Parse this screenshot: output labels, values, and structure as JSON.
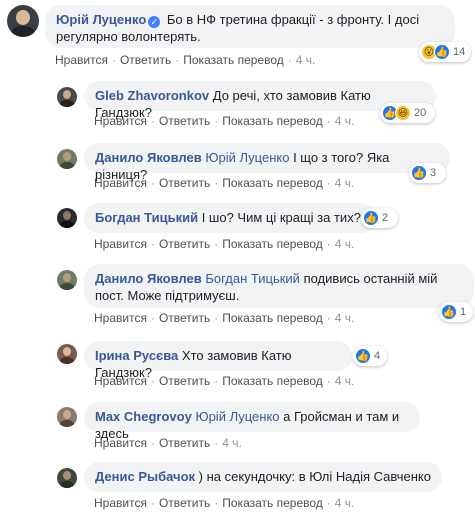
{
  "comments": [
    {
      "author": "Юрій Луценко",
      "verified": true,
      "text": "Бо в НФ третина фракції - з фронту. І досі регулярно волонтерять.",
      "actions": {
        "like": "Нравится",
        "reply": "Ответить",
        "translate": "Показать перевод",
        "time": "4 ч."
      },
      "reactions": {
        "icons": [
          "wow-icon",
          "like-icon"
        ],
        "count": "14"
      },
      "colors": {
        "avatar": "#3a3f45",
        "face": "#d9b89a"
      }
    },
    {
      "author": "Gleb Zhavoronkov",
      "mention": "",
      "text": "До речі, хто замовив Катю Гандзюк?",
      "actions": {
        "like": "Нравится",
        "reply": "Ответить",
        "translate": "Показать перевод",
        "time": "4 ч."
      },
      "reactions": {
        "icons": [
          "like-icon",
          "haha-icon"
        ],
        "count": "20"
      },
      "colors": {
        "avatar": "#4a4a4a",
        "face": "#c9a98a"
      }
    },
    {
      "author": "Данило Яковлев",
      "mention": "Юрій Луценко",
      "text": "І що з того? Яка різниця?",
      "actions": {
        "like": "Нравится",
        "reply": "Ответить",
        "translate": "Показать перевод",
        "time": "4 ч."
      },
      "reactions": {
        "icons": [
          "like-icon"
        ],
        "count": "3"
      },
      "colors": {
        "avatar": "#6e7d66",
        "face": "#b59a80"
      }
    },
    {
      "author": "Богдан Тицький",
      "mention": "",
      "text": "І шо? Чим ці кращі за тих?",
      "actions": {
        "like": "Нравится",
        "reply": "Ответить",
        "translate": "Показать перевод",
        "time": "4 ч."
      },
      "reactions": {
        "icons": [
          "like-icon"
        ],
        "count": "2"
      },
      "colors": {
        "avatar": "#2b2b2b",
        "face": "#8a7a6a"
      }
    },
    {
      "author": "Данило Яковлев",
      "mention": "Богдан Тицький",
      "text_line1": "подивись останній мій",
      "text_line2": "пост. Може підтримуєш.",
      "actions": {
        "like": "Нравится",
        "reply": "Ответить",
        "translate": "Показать перевод",
        "time": "4 ч."
      },
      "reactions": {
        "icons": [
          "like-icon"
        ],
        "count": "1"
      },
      "colors": {
        "avatar": "#6e7d66",
        "face": "#b59a80"
      }
    },
    {
      "author": "Ірина Русєва",
      "mention": "",
      "text": "Хто замовив Катю Гандзюк?",
      "actions": {
        "like": "Нравится",
        "reply": "Ответить",
        "translate": "Показать перевод",
        "time": "4 ч."
      },
      "reactions": {
        "icons": [
          "like-icon"
        ],
        "count": "4"
      },
      "colors": {
        "avatar": "#7a5a4a",
        "face": "#d8b79c"
      }
    },
    {
      "author": "Max Chegrovoy",
      "mention": "Юрій Луценко",
      "text": "а Гройсман и там и здесь",
      "actions": {
        "like": "Нравится",
        "reply": "Ответить",
        "translate": "Показать перевод",
        "time": "4 ч."
      },
      "colors": {
        "avatar": "#8a7a70",
        "face": "#caa88c"
      }
    },
    {
      "author": "Денис Рыбачок",
      "mention": "",
      "text": ") на секундочку: в Юлі Надія Савченко",
      "actions": {
        "like": "Нравится",
        "reply": "Ответить",
        "translate": "Показать перевод",
        "time": "4 ч."
      },
      "colors": {
        "avatar": "#3d4a3a",
        "face": "#a89078"
      }
    }
  ]
}
